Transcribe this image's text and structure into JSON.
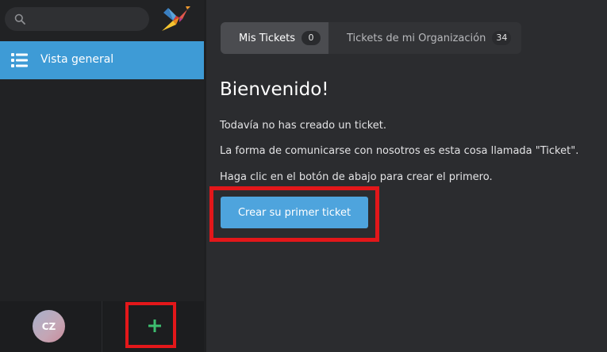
{
  "sidebar": {
    "search": {
      "placeholder": "",
      "value": ""
    },
    "logo_icon": "bird-logo-icon",
    "nav_items": [
      {
        "icon": "list-icon",
        "label": "Vista general",
        "active": true
      }
    ],
    "user": {
      "initials": "CZ"
    },
    "new_ticket_icon": "plus-icon"
  },
  "main": {
    "tabs": [
      {
        "label": "Mis Tickets",
        "count": "0",
        "active": true
      },
      {
        "label": "Tickets de mi Organización",
        "count": "34",
        "active": false
      }
    ],
    "heading": "Bienvenido!",
    "paragraphs": [
      "Todavía no has creado un ticket.",
      "La forma de comunicarse con nosotros es esta cosa llamada \"Ticket\".",
      "Haga clic en el botón de abajo para crear el primero."
    ],
    "cta_label": "Crear su primer ticket"
  },
  "colors": {
    "accent": "#4ea4dd",
    "nav_active": "#3e9bd6",
    "highlight": "#e3171a",
    "plus": "#3dbd6f"
  }
}
